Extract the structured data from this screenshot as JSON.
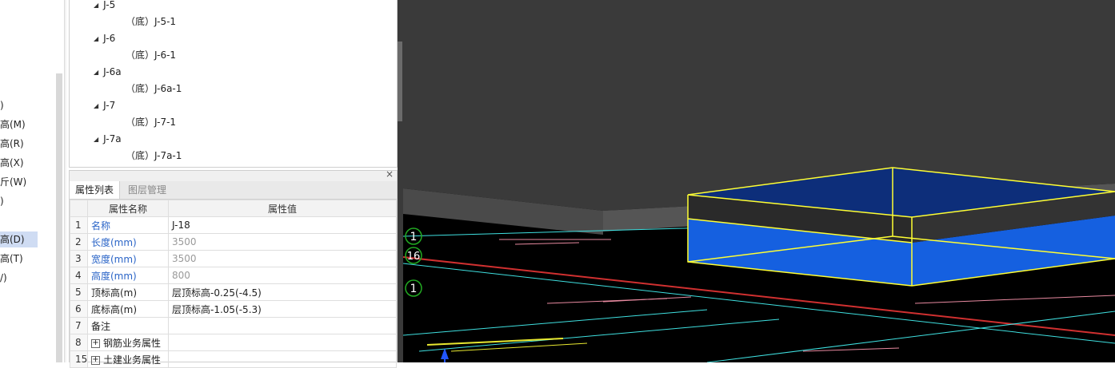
{
  "left_menu": {
    "items": [
      {
        "label": ")",
        "selected": false
      },
      {
        "label": "高(M)",
        "selected": false
      },
      {
        "label": "高(R)",
        "selected": false
      },
      {
        "label": "高(X)",
        "selected": false
      },
      {
        "label": "斤(W)",
        "selected": false
      },
      {
        "label": ")",
        "selected": false
      },
      {
        "label": "高(D)",
        "selected": true
      },
      {
        "label": "高(T)",
        "selected": false
      },
      {
        "label": "/)",
        "selected": false
      }
    ]
  },
  "tree": {
    "nodes": [
      {
        "label": "J-5",
        "level": 1
      },
      {
        "label": "（底）J-5-1",
        "level": 2
      },
      {
        "label": "J-6",
        "level": 1
      },
      {
        "label": "（底）J-6-1",
        "level": 2
      },
      {
        "label": "J-6a",
        "level": 1
      },
      {
        "label": "（底）J-6a-1",
        "level": 2
      },
      {
        "label": "J-7",
        "level": 1
      },
      {
        "label": "（底）J-7-1",
        "level": 2
      },
      {
        "label": "J-7a",
        "level": 1
      },
      {
        "label": "（底）J-7a-1",
        "level": 2
      }
    ]
  },
  "props": {
    "close_label": "×",
    "tabs": [
      {
        "label": "属性列表",
        "active": true
      },
      {
        "label": "图层管理",
        "active": false
      }
    ],
    "header": {
      "name_col": "属性名称",
      "value_col": "属性值"
    },
    "rows": [
      {
        "idx": "1",
        "name": "名称",
        "value": "J-18",
        "blue": true,
        "grey": false,
        "plus": false
      },
      {
        "idx": "2",
        "name": "长度(mm)",
        "value": "3500",
        "blue": true,
        "grey": true,
        "plus": false
      },
      {
        "idx": "3",
        "name": "宽度(mm)",
        "value": "3500",
        "blue": true,
        "grey": true,
        "plus": false
      },
      {
        "idx": "4",
        "name": "高度(mm)",
        "value": "800",
        "blue": true,
        "grey": true,
        "plus": false
      },
      {
        "idx": "5",
        "name": "顶标高(m)",
        "value": "层顶标高-0.25(-4.5)",
        "blue": false,
        "grey": false,
        "plus": false
      },
      {
        "idx": "6",
        "name": "底标高(m)",
        "value": "层顶标高-1.05(-5.3)",
        "blue": false,
        "grey": false,
        "plus": false
      },
      {
        "idx": "7",
        "name": "备注",
        "value": "",
        "blue": false,
        "grey": false,
        "plus": false
      },
      {
        "idx": "8",
        "name": "钢筋业务属性",
        "value": "",
        "blue": false,
        "grey": false,
        "plus": true
      },
      {
        "idx": "15",
        "name": "土建业务属性",
        "value": "",
        "blue": false,
        "grey": false,
        "plus": true
      }
    ]
  },
  "viewport": {
    "axis_markers": [
      "1",
      "16",
      "1"
    ],
    "colors": {
      "slab_top": "#3a3a3a",
      "slab_front": "#4a4a4a",
      "footing_blue": "#1560e0",
      "footing_top_blue": "#0d2e7a",
      "selection_yellow": "#ffff33",
      "cad_cyan": "#3fe0e0",
      "cad_red": "#d03030",
      "cad_pink": "#e88aa0",
      "cad_yellow": "#e8e830",
      "axis_green": "#22aa22"
    }
  }
}
